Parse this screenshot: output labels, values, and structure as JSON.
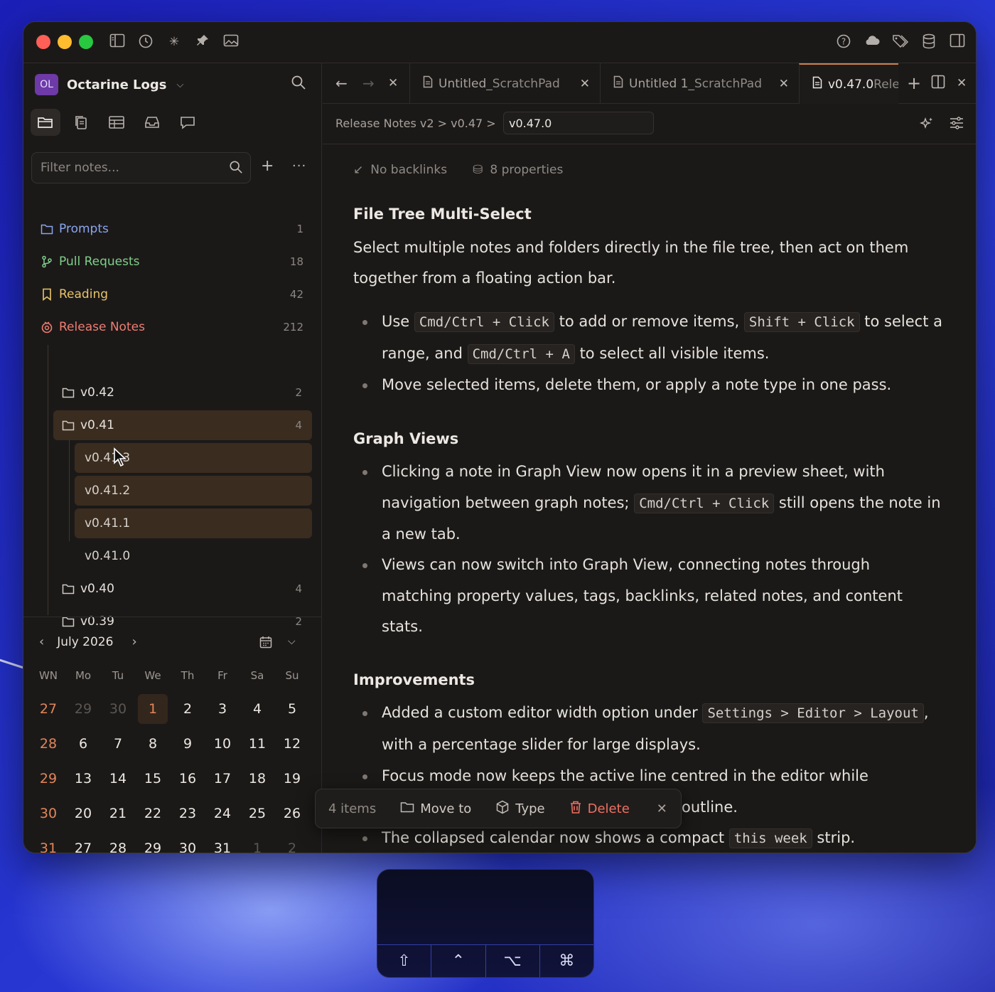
{
  "app": {
    "vault_initials": "OL",
    "vault_name": "Octarine Logs"
  },
  "sidebar": {
    "filter_placeholder": "Filter notes...",
    "folders": [
      {
        "label": "Prompts",
        "count": "1",
        "color": "#8aa6f0",
        "icon": "folder-icon"
      },
      {
        "label": "Pull Requests",
        "count": "18",
        "color": "#7fcf8a",
        "icon": "git-branch-icon"
      },
      {
        "label": "Reading",
        "count": "42",
        "color": "#e8c46a",
        "icon": "bookmark-icon"
      },
      {
        "label": "Release Notes",
        "count": "212",
        "color": "#f07d72",
        "icon": "release-icon"
      }
    ],
    "release_children": [
      {
        "label": "v0.42",
        "count": "2"
      },
      {
        "label": "v0.41",
        "count": "4"
      },
      {
        "label": "v0.40",
        "count": "4"
      },
      {
        "label": "v0.39",
        "count": "2"
      }
    ],
    "v041_notes": [
      "v0.41.3",
      "v0.41.2",
      "v0.41.1",
      "v0.41.0"
    ]
  },
  "calendar": {
    "month_label": "July 2026",
    "dow": [
      "WN",
      "Mo",
      "Tu",
      "We",
      "Th",
      "Fr",
      "Sa",
      "Su"
    ],
    "weeks": [
      [
        "27",
        "29",
        "30",
        "1",
        "2",
        "3",
        "4",
        "5"
      ],
      [
        "28",
        "6",
        "7",
        "8",
        "9",
        "10",
        "11",
        "12"
      ],
      [
        "29",
        "13",
        "14",
        "15",
        "16",
        "17",
        "18",
        "19"
      ],
      [
        "30",
        "20",
        "21",
        "22",
        "23",
        "24",
        "25",
        "26"
      ],
      [
        "31",
        "27",
        "28",
        "29",
        "30",
        "31",
        "1",
        "2"
      ]
    ],
    "today": "1"
  },
  "tabs": [
    {
      "label": "Untitled",
      "suffix": " _ScratchPad"
    },
    {
      "label": "Untitled 1",
      "suffix": " _ScratchPad"
    },
    {
      "label": "v0.47.0",
      "suffix": " Rele"
    }
  ],
  "breadcrumb": {
    "path": "Release Notes v2 > v0.47 >",
    "current": "v0.47.0"
  },
  "note": {
    "backlinks": "No backlinks",
    "properties": "8 properties",
    "h1": "File Tree Multi-Select",
    "p1": "Select multiple notes and folders directly in the file tree, then act on them together from a floating action bar.",
    "b1a": "Use ",
    "b1code1": "Cmd/Ctrl + Click",
    "b1b": " to add or remove items, ",
    "b1code2": "Shift + Click",
    "b1c": " to select a range, and ",
    "b1code3": "Cmd/Ctrl + A",
    "b1d": " to select all visible items.",
    "b2": "Move selected items, delete them, or apply a note type in one pass.",
    "h2": "Graph Views",
    "b3a": "Clicking a note in Graph View now opens it in a preview sheet, with navigation between graph notes; ",
    "b3code": "Cmd/Ctrl + Click",
    "b3b": " still opens the note in a new tab.",
    "b4": "Views can now switch into Graph View, connecting notes through matching property values, tags, backlinks, related notes, and content stats.",
    "h3": "Improvements",
    "b5a": "Added a custom editor width option under ",
    "b5code": "Settings > Editor > Layout",
    "b5b": ", with a percentage slider for large displays.",
    "b6": "Focus mode now keeps the active line centred in the editor while",
    "b6tail": "outline.",
    "b7a": "The collapsed calendar now shows a compact ",
    "b7code": "this week",
    "b7b": " strip."
  },
  "action_bar": {
    "count": "4 items",
    "move": "Move to",
    "type": "Type",
    "delete": "Delete"
  },
  "keyboard": {
    "keys": [
      "⇧",
      "⌃",
      "⌥",
      "⌘"
    ]
  },
  "colors": {
    "accent": "#e2855a",
    "delete": "#f07063",
    "selected_row": "#3a2c1f"
  }
}
